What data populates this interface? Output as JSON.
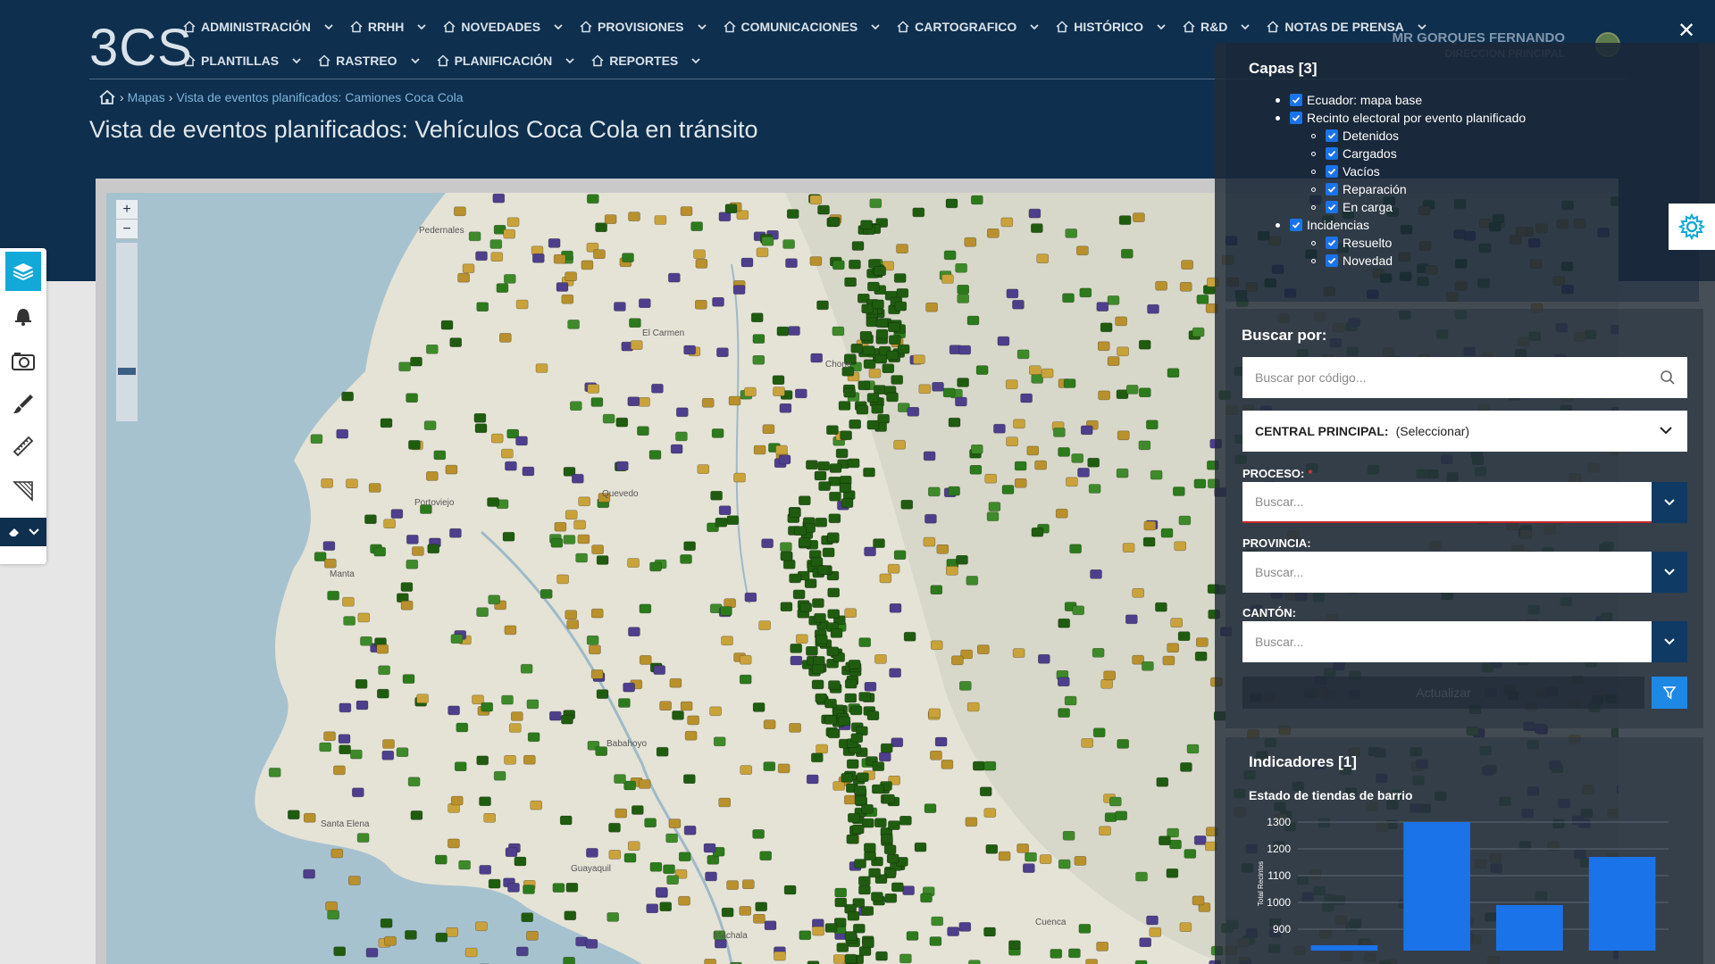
{
  "app": {
    "logo": "3CS"
  },
  "nav": {
    "row1": [
      {
        "label": "ADMINISTRACIÓN"
      },
      {
        "label": "RRHH"
      },
      {
        "label": "NOVEDADES"
      },
      {
        "label": "PROVISIONES"
      },
      {
        "label": "COMUNICACIONES"
      },
      {
        "label": "CARTOGRAFICO"
      },
      {
        "label": "HISTÓRICO"
      },
      {
        "label": "R&D"
      },
      {
        "label": "NOTAS DE PRENSA"
      }
    ],
    "row2": [
      {
        "label": "PLANTILLAS"
      },
      {
        "label": "RASTREO"
      },
      {
        "label": "PLANIFICACIÓN"
      },
      {
        "label": "REPORTES"
      }
    ]
  },
  "user": {
    "name": "MR GORQUES FERNANDO",
    "role": "DIRECCION PRINCIPAL"
  },
  "breadcrumb": {
    "items": [
      "Mapas",
      "Vista de eventos planificados: Camiones Coca Cola"
    ]
  },
  "page": {
    "title": "Vista de eventos planificados: Vehículos Coca Cola en tránsito"
  },
  "layers": {
    "title": "Capas [3]",
    "items": [
      {
        "label": "Ecuador: mapa base",
        "level": 1
      },
      {
        "label": "Recinto electoral por evento planificado",
        "level": 1
      },
      {
        "label": "Detenidos",
        "level": 2
      },
      {
        "label": "Cargados",
        "level": 2
      },
      {
        "label": "Vacíos",
        "level": 2
      },
      {
        "label": "Reparación",
        "level": 2
      },
      {
        "label": "En carga",
        "level": 2
      },
      {
        "label": "Incidencias",
        "level": 1
      },
      {
        "label": "Resuelto",
        "level": 2
      },
      {
        "label": "Novedad",
        "level": 2
      }
    ]
  },
  "search": {
    "title": "Buscar por:",
    "placeholder": "Buscar por código...",
    "central_label": "CENTRAL PRINCIPAL:",
    "central_value": "(Seleccionar)",
    "proceso_label": "PROCESO:",
    "proceso_required": "*",
    "proceso_placeholder": "Buscar...",
    "provincia_label": "PROVINCIA:",
    "provincia_placeholder": "Buscar...",
    "canton_label": "CANTÓN:",
    "canton_placeholder": "Buscar...",
    "update_label": "Actualizar"
  },
  "indicators": {
    "title": "Indicadores [1]",
    "subtitle": "Estado de tiendas de barrio"
  },
  "chart_data": {
    "type": "bar",
    "title": "Estado de tiendas de barrio",
    "ylabel": "Total Recintos",
    "categories": [
      "",
      "",
      "",
      ""
    ],
    "values": [
      840,
      1300,
      990,
      1170
    ],
    "yticks": [
      900,
      1000,
      1100,
      1200,
      1300
    ],
    "ylim": [
      820,
      1320
    ],
    "color": "#1a73e8",
    "grid": true
  },
  "map_labels": [
    "Pedernales",
    "El Carmen",
    "Chone",
    "Portoviejo",
    "Manta",
    "Quevedo",
    "Babahoyo",
    "Guayaquil",
    "Machala",
    "Santa Elena",
    "Cuenca"
  ],
  "colors": {
    "accent": "#12a8d8",
    "primary": "#0e2f4e",
    "bar": "#1a73e8"
  }
}
